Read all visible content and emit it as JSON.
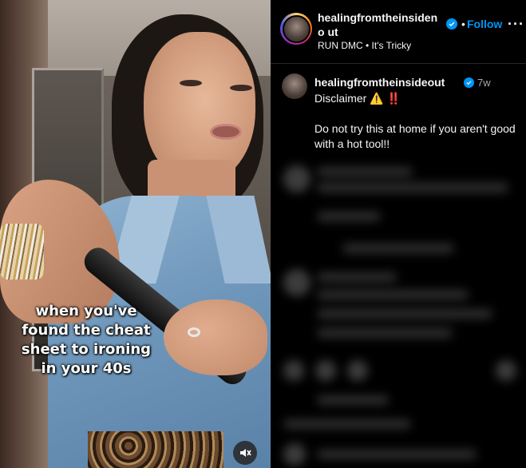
{
  "media": {
    "caption_overlay": "when you've\nfound the cheat\nsheet to ironing\nin your 40s",
    "mute_icon": "speaker-muted-icon"
  },
  "header": {
    "username": "healingfromtheinsideno ut",
    "verified_icon": "verified-badge-icon",
    "separator": "•",
    "follow_label": "Follow",
    "more_label": "···",
    "audio": "RUN DMC • It's Tricky"
  },
  "caption": {
    "username": "healingfromtheinsideout",
    "time": "7w",
    "text": "Disclaimer ⚠️ ‼️\n\nDo not try this at home if you aren't good with a hot tool!!"
  },
  "colors": {
    "accent": "#0095f6",
    "background": "#000000",
    "muted_text": "#a8a8a8"
  }
}
